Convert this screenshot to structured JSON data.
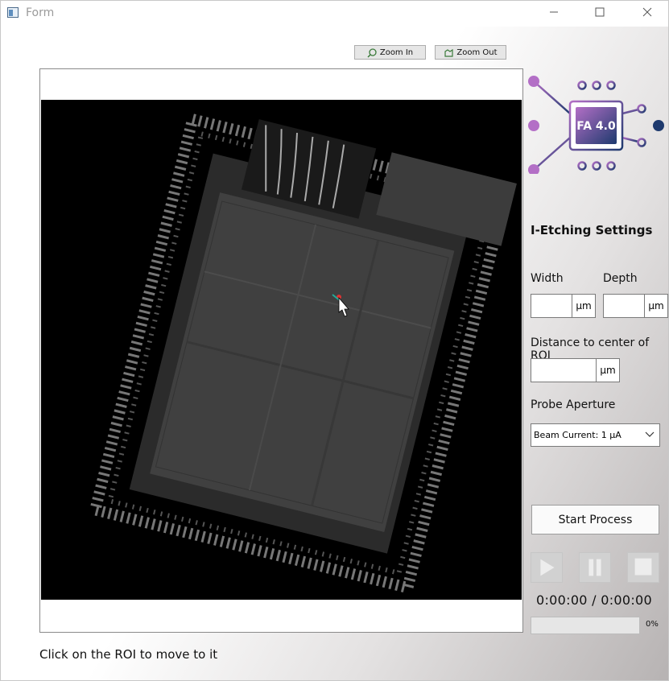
{
  "window": {
    "title": "Form"
  },
  "toolbar": {
    "zoom_in": "Zoom In",
    "zoom_out": "Zoom Out"
  },
  "logo": {
    "text": "FA 4.0"
  },
  "settings": {
    "title": "I-Etching Settings",
    "width_label": "Width",
    "depth_label": "Depth",
    "width_value": "",
    "depth_value": "",
    "unit": "μm",
    "distance_label": "Distance to center of ROI",
    "distance_value": "",
    "aperture_label": "Probe Aperture",
    "aperture_selected": "Beam Current: 1 μA"
  },
  "process": {
    "start_label": "Start Process",
    "timer": "0:00:00 / 0:00:00",
    "progress_fraction": 0,
    "progress_text": "0%"
  },
  "status_text": "Click on the ROI to move to it",
  "colors": {
    "progress_fill": "#06b025",
    "logo_purple": "#b36fc6",
    "logo_navy": "#1e3a6e"
  }
}
